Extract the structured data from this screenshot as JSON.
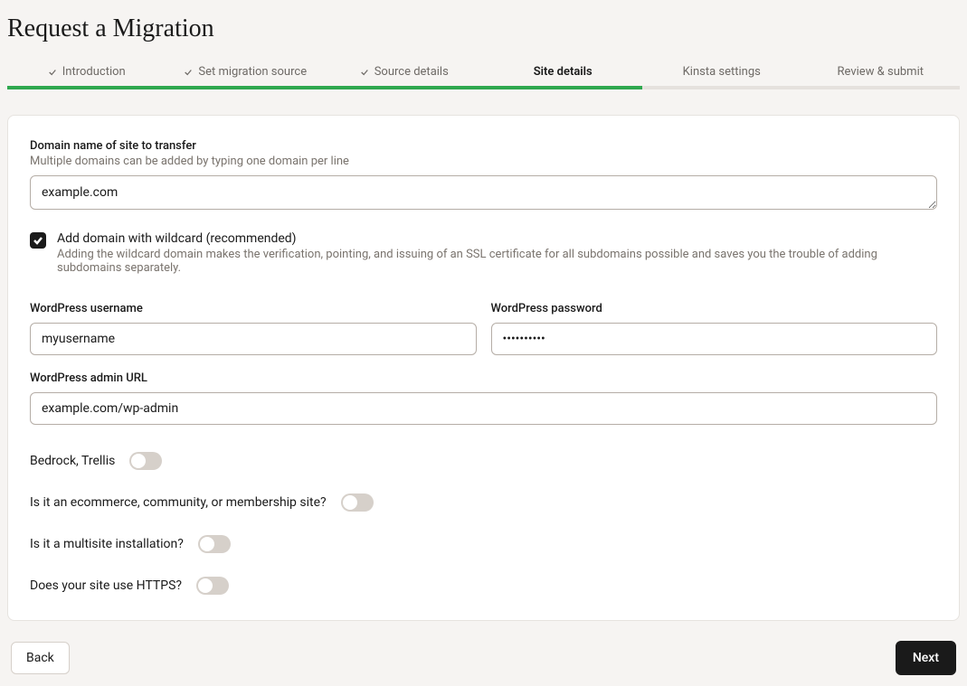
{
  "page": {
    "title": "Request a Migration"
  },
  "stepper": {
    "steps": [
      {
        "label": "Introduction",
        "done": true
      },
      {
        "label": "Set migration source",
        "done": true
      },
      {
        "label": "Source details",
        "done": true
      },
      {
        "label": "Site details",
        "active": true
      },
      {
        "label": "Kinsta settings"
      },
      {
        "label": "Review & submit"
      }
    ]
  },
  "form": {
    "domain": {
      "label": "Domain name of site to transfer",
      "sublabel": "Multiple domains can be added by typing one domain per line",
      "value": "example.com"
    },
    "wildcard": {
      "label": "Add domain with wildcard (recommended)",
      "sublabel": "Adding the wildcard domain makes the verification, pointing, and issuing of an SSL certificate for all subdomains possible and saves you the trouble of adding subdomains separately.",
      "checked": true
    },
    "wp_user": {
      "label": "WordPress username",
      "value": "myusername"
    },
    "wp_pass": {
      "label": "WordPress password",
      "value": "••••••••••"
    },
    "wp_admin": {
      "label": "WordPress admin URL",
      "value": "example.com/wp-admin"
    },
    "toggles": {
      "bedrock": {
        "label": "Bedrock, Trellis",
        "value": false
      },
      "ecommerce": {
        "label": "Is it an ecommerce, community, or membership site?",
        "value": false
      },
      "multisite": {
        "label": "Is it a multisite installation?",
        "value": false
      },
      "https": {
        "label": "Does your site use HTTPS?",
        "value": false
      }
    }
  },
  "footer": {
    "back": "Back",
    "next": "Next"
  }
}
